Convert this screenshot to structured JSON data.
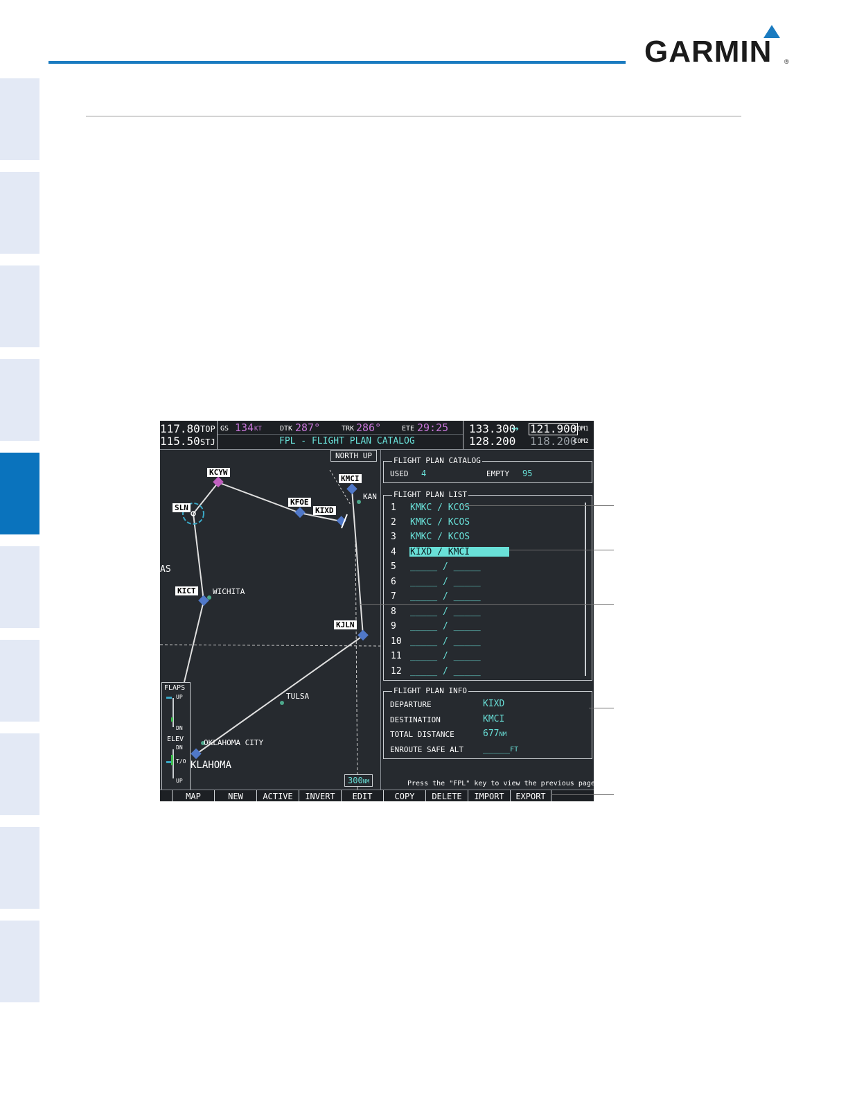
{
  "brand": {
    "logo_text": "GARMIN",
    "reg_mark": "®",
    "accent_color": "#1a7bc0"
  },
  "side_tabs": {
    "count": 10,
    "active_index": 4,
    "active_color": "#0a73bd",
    "inactive_color": "#e3e9f5"
  },
  "mfd": {
    "nav": {
      "active_freq": "117.80",
      "standby_freq": "115.50",
      "id1": "TOP",
      "id2": "STJ"
    },
    "data_bar": {
      "gs_label": "GS",
      "gs_value": "134",
      "gs_unit": "KT",
      "dtk_label": "DTK",
      "dtk_value": "287°",
      "trk_label": "TRK",
      "trk_value": "286°",
      "ete_label": "ETE",
      "ete_value": "29:25"
    },
    "page_title": "FPL - FLIGHT PLAN CATALOG",
    "com": {
      "com1_active": "133.300",
      "swap_arrow": "↔",
      "com1_standby": "121.900",
      "com1_label": "COM1",
      "com2_active": "128.200",
      "com2_standby": "118.200",
      "com2_label": "COM2"
    },
    "map": {
      "orientation": "NORTH UP",
      "range": "300",
      "range_unit": "NM",
      "waypoints": [
        "KCYW",
        "SLN",
        "KFOE",
        "KIXD",
        "KMCI",
        "KICT",
        "KJLN"
      ],
      "cities": [
        "WICHITA",
        "TULSA",
        "OKLAHOMA CITY"
      ],
      "region_labels": [
        "KAN",
        "AS",
        "KLAHOMA"
      ],
      "legend": {
        "flaps_label": "FLAPS",
        "flaps_up": "UP",
        "flaps_dn": "DN",
        "elev_label": "ELEV",
        "elev_dn": "DN",
        "elev_to": "T/O",
        "elev_up": "UP"
      }
    },
    "catalog": {
      "title": "FLIGHT PLAN CATALOG",
      "used_label": "USED",
      "used_value": "4",
      "empty_label": "EMPTY",
      "empty_value": "95"
    },
    "plan_list": {
      "title": "FLIGHT PLAN LIST",
      "items": [
        {
          "num": "1",
          "route": "KMKC / KCOS"
        },
        {
          "num": "2",
          "route": "KMKC / KCOS"
        },
        {
          "num": "3",
          "route": "KMKC / KCOS"
        },
        {
          "num": "4",
          "route": "KIXD / KMCI"
        },
        {
          "num": "5",
          "route": "_____ / _____"
        },
        {
          "num": "6",
          "route": "_____ / _____"
        },
        {
          "num": "7",
          "route": "_____ / _____"
        },
        {
          "num": "8",
          "route": "_____ / _____"
        },
        {
          "num": "9",
          "route": "_____ / _____"
        },
        {
          "num": "10",
          "route": "_____ / _____"
        },
        {
          "num": "11",
          "route": "_____ / _____"
        },
        {
          "num": "12",
          "route": "_____ / _____"
        }
      ],
      "selected_index": 3
    },
    "plan_info": {
      "title": "FLIGHT PLAN INFO",
      "departure_label": "DEPARTURE",
      "departure_value": "KIXD",
      "destination_label": "DESTINATION",
      "destination_value": "KMCI",
      "distance_label": "TOTAL DISTANCE",
      "distance_value": "677",
      "distance_unit": "NM",
      "safe_alt_label": "ENROUTE SAFE ALT",
      "safe_alt_value": "_____",
      "safe_alt_unit": "FT"
    },
    "prompt": "Press the \"FPL\" key to view the previous page",
    "softkeys": [
      "MAP",
      "NEW",
      "ACTIVE",
      "INVERT",
      "EDIT",
      "COPY",
      "DELETE",
      "IMPORT",
      "EXPORT"
    ]
  }
}
